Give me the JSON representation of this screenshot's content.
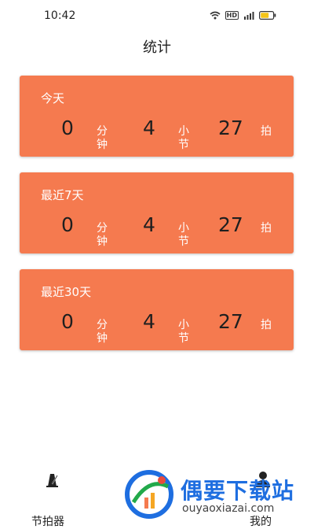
{
  "status": {
    "time": "10:42",
    "hd": "HD"
  },
  "page": {
    "title": "统计"
  },
  "cards": [
    {
      "title": "今天",
      "minutes": "0",
      "minutes_unit": "分钟",
      "bars": "4",
      "bars_unit": "小节",
      "beats": "27",
      "beats_unit": "拍"
    },
    {
      "title": "最近7天",
      "minutes": "0",
      "minutes_unit": "分钟",
      "bars": "4",
      "bars_unit": "小节",
      "beats": "27",
      "beats_unit": "拍"
    },
    {
      "title": "最近30天",
      "minutes": "0",
      "minutes_unit": "分钟",
      "bars": "4",
      "bars_unit": "小节",
      "beats": "27",
      "beats_unit": "拍"
    }
  ],
  "nav": {
    "metronome_label": "节拍器",
    "mine_label": "我的"
  },
  "watermark": {
    "text": "偶要下载站",
    "url": "ouyaoxiazai.com"
  },
  "colors": {
    "card": "#F57A4F",
    "watermark": "#1E6EE0"
  }
}
